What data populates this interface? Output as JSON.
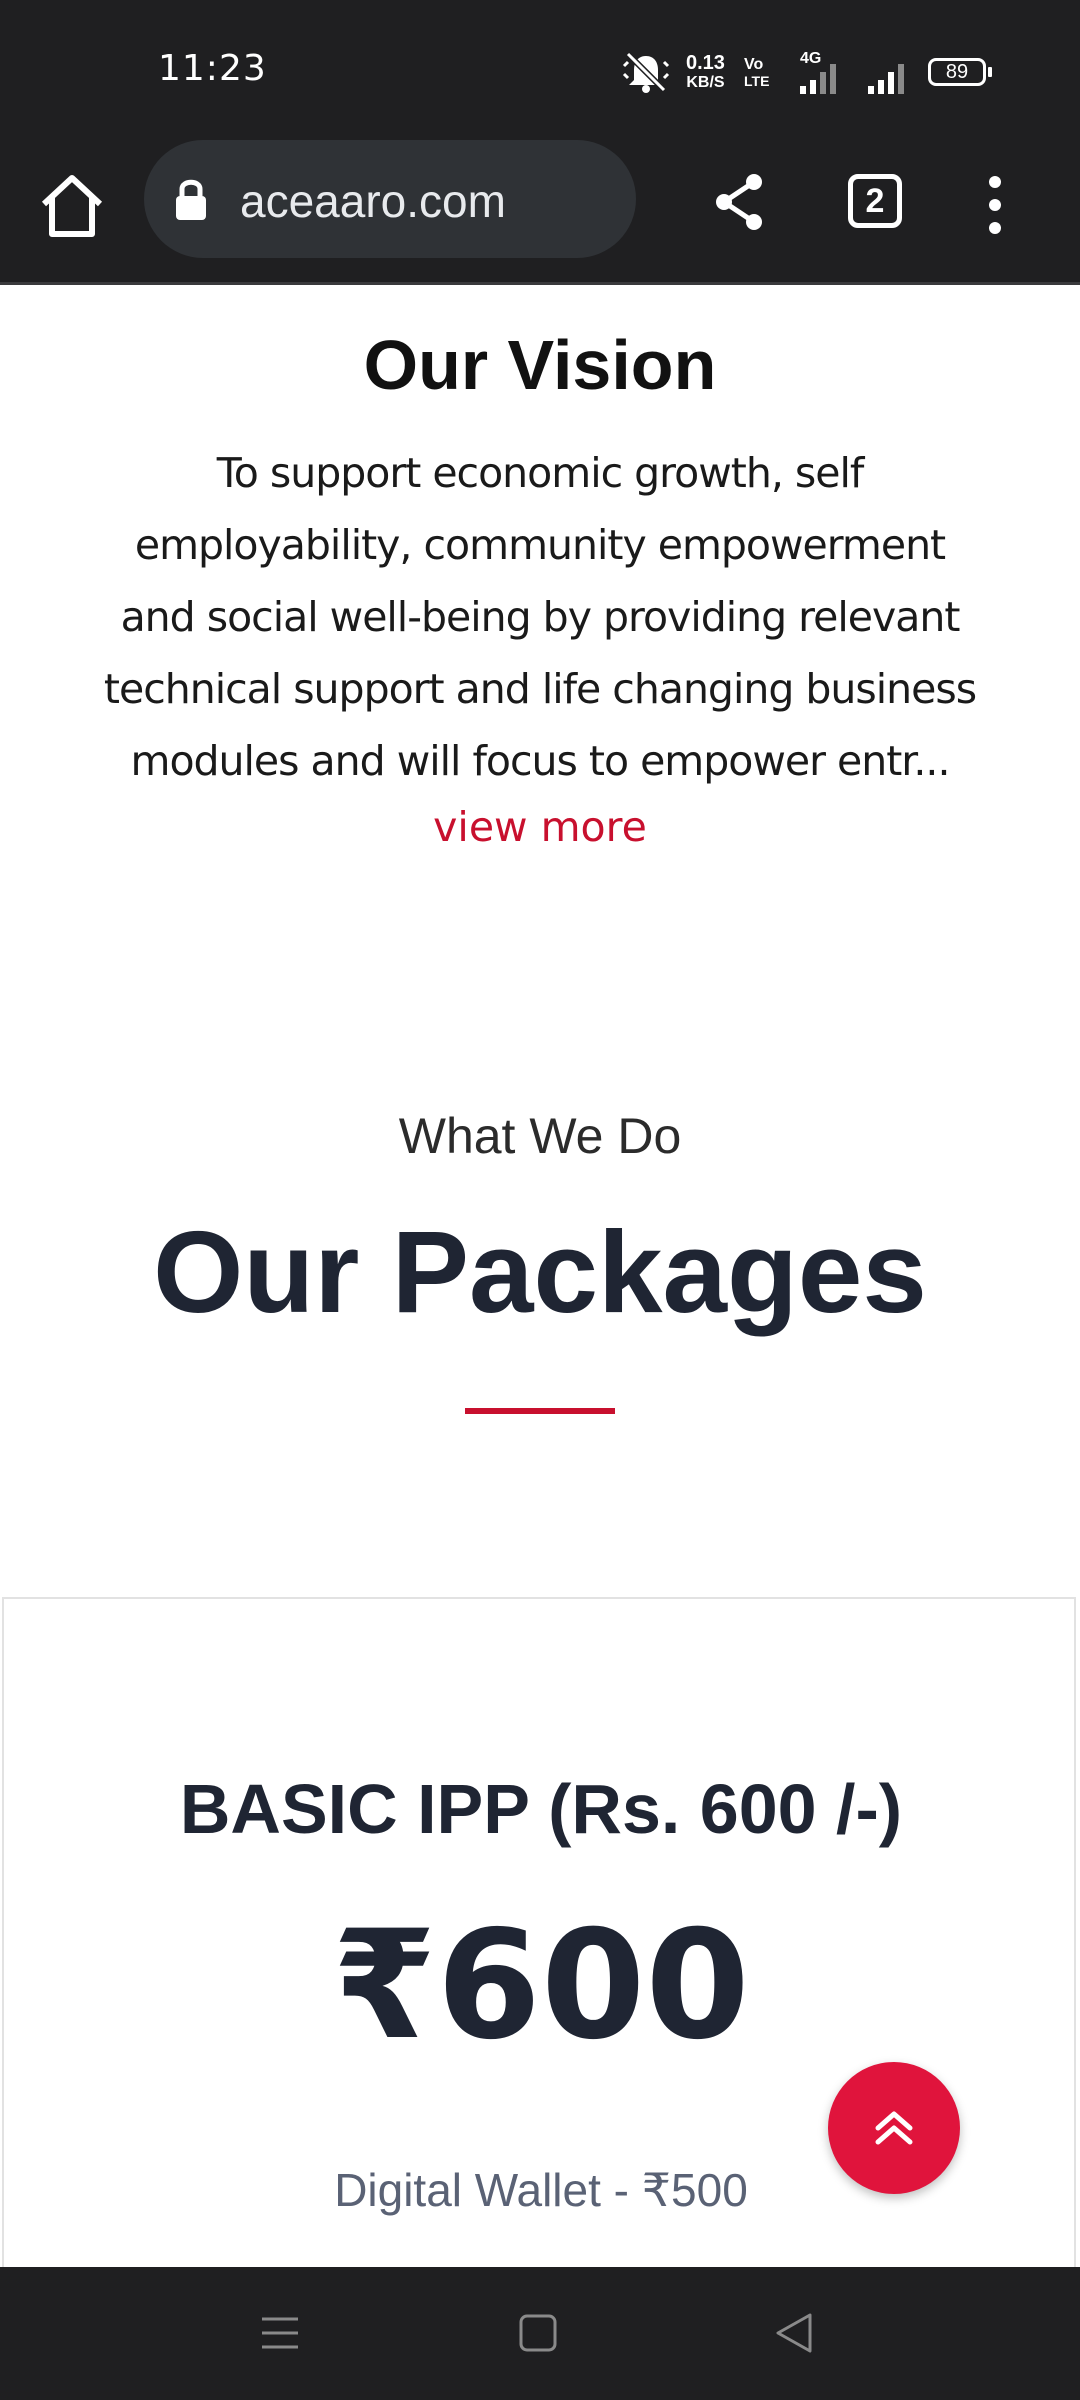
{
  "status_bar": {
    "time": "11:23",
    "net_speed_value": "0.13",
    "net_speed_unit": "KB/S",
    "volte_line1": "Vo",
    "volte_line2": "LTE",
    "network_type": "4G",
    "battery": "89",
    "icons": [
      "mute-icon",
      "volte-icon",
      "signal-icon",
      "signal-icon",
      "battery-icon"
    ]
  },
  "browser": {
    "url": "aceaaro.com",
    "tab_count": "2",
    "icons": [
      "home-icon",
      "lock-icon",
      "share-icon",
      "tabs-icon",
      "more-vert-icon"
    ]
  },
  "vision": {
    "title": "Our Vision",
    "text": "To support economic growth, self employability, community empowerment and social well-being by providing relevant technical support and life changing business modules and will focus to empower entr...",
    "view_more": "view more"
  },
  "packages": {
    "subtitle": "What We Do",
    "title": "Our Packages",
    "items": [
      {
        "name": "BASIC IPP (Rs. 600 /-)",
        "price": "₹600",
        "feature": "Digital Wallet - ₹500"
      }
    ]
  },
  "colors": {
    "accent": "#c8102e",
    "fab": "#e0143c",
    "heading": "#1f2533",
    "chrome": "#1f1f21"
  },
  "nav_bar": {
    "icons": [
      "menu-icon",
      "home-square-icon",
      "back-icon"
    ]
  }
}
